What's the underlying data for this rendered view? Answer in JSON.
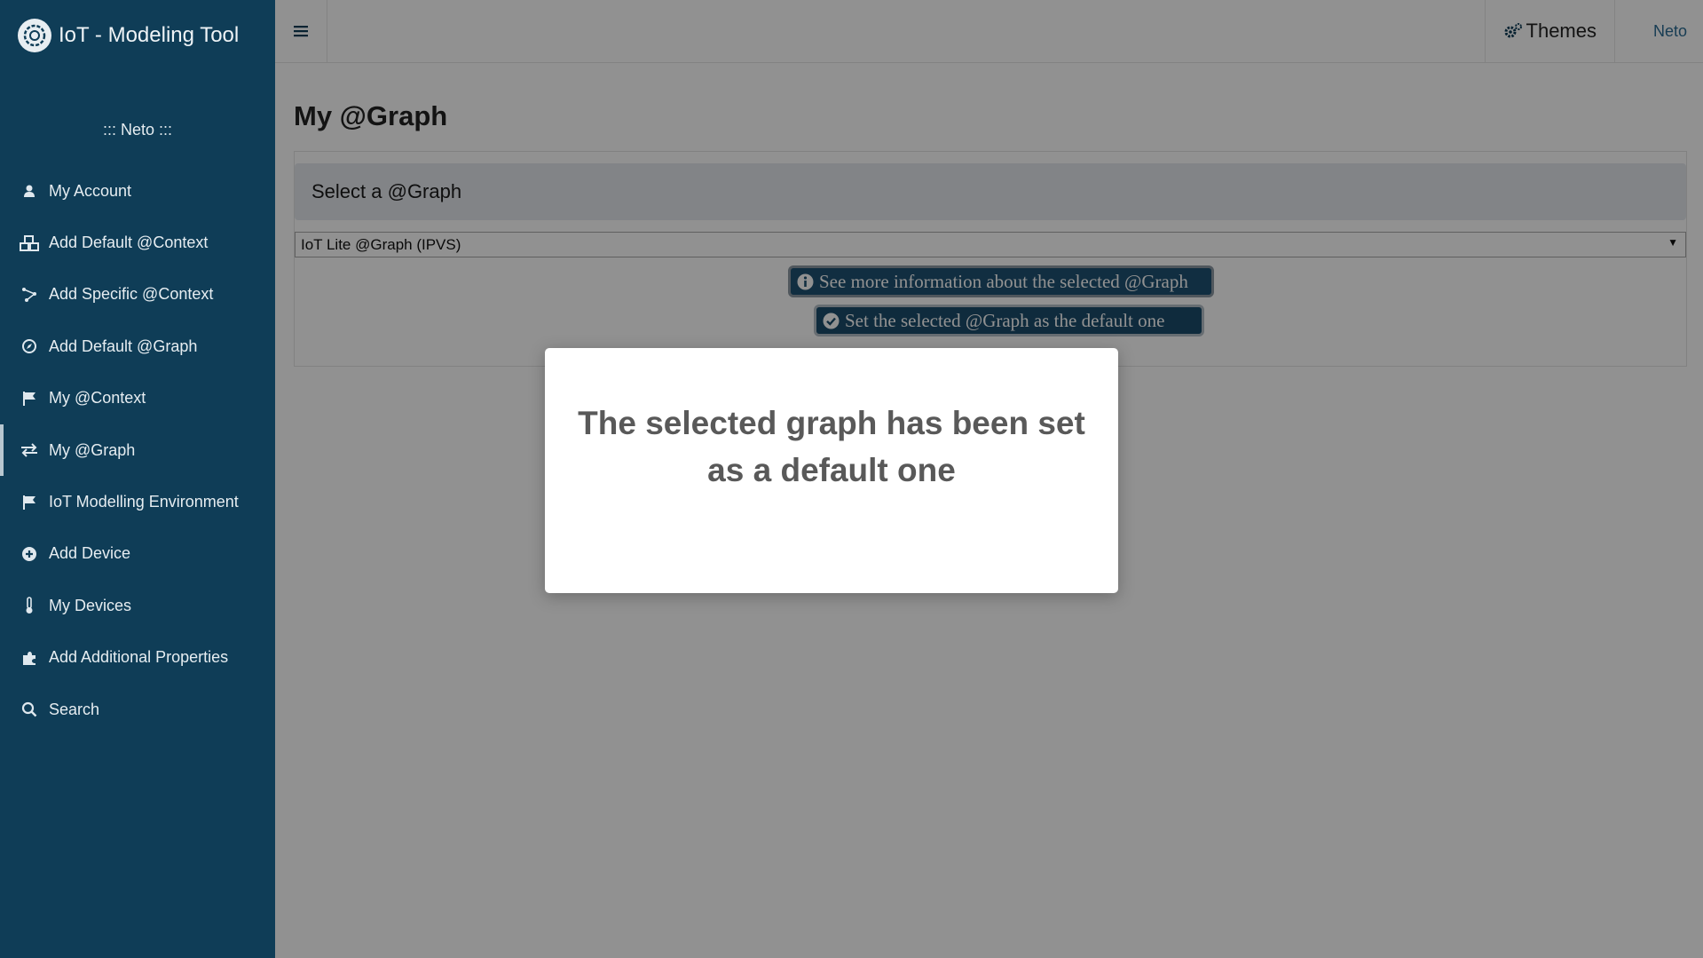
{
  "app": {
    "title": "IoT - Modeling Tool",
    "logo_icon": "gear-logo-icon"
  },
  "sidebar": {
    "user_line": "::: Neto :::",
    "items": [
      {
        "label": "My Account",
        "icon": "user-icon"
      },
      {
        "label": "Add Default @Context",
        "icon": "cubes-icon"
      },
      {
        "label": "Add Specific @Context",
        "icon": "sitemap-icon"
      },
      {
        "label": "Add Default @Graph",
        "icon": "compass-icon"
      },
      {
        "label": "My @Context",
        "icon": "flag-icon"
      },
      {
        "label": "My @Graph",
        "icon": "exchange-icon",
        "active": true
      },
      {
        "label": "IoT Modelling Environment",
        "icon": "flag-icon"
      },
      {
        "label": "Add Device",
        "icon": "plus-circle-icon"
      },
      {
        "label": "My Devices",
        "icon": "thermometer-icon"
      },
      {
        "label": "Add Additional Properties",
        "icon": "puzzle-icon"
      },
      {
        "label": "Search",
        "icon": "search-icon"
      }
    ]
  },
  "topbar": {
    "menu_icon": "hamburger-icon",
    "themes_label": "Themes",
    "themes_icon": "gears-icon",
    "user_label": "Neto"
  },
  "main": {
    "page_title": "My @Graph",
    "panel_heading": "Select a @Graph",
    "select": {
      "selected": "IoT Lite @Graph (IPVS)"
    },
    "info_button": "See more information about the selected @Graph",
    "default_button": "Set the selected @Graph as the default one"
  },
  "modal": {
    "message": "The selected graph has been set as a default one"
  },
  "colors": {
    "sidebar_bg": "#0f3d57",
    "accent": "#1e5272",
    "overlay": "rgba(0,0,0,0.43)"
  }
}
